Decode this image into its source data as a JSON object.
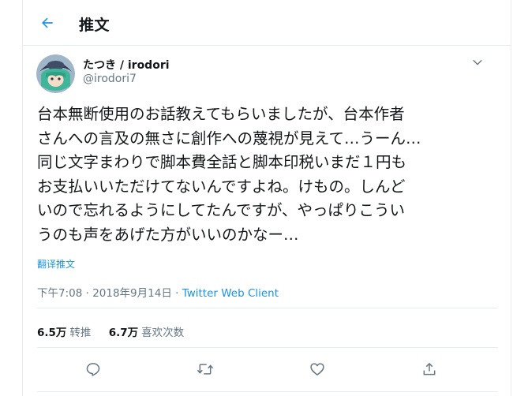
{
  "header": {
    "title": "推文"
  },
  "tweet": {
    "display_name": "たつき / irodori",
    "handle": "@irodori7",
    "lines": [
      "台本無断使用のお話教えてもらいましたが、台本作者",
      "さんへの言及の無さに創作への蔑視が見えて…うーん…",
      "同じ文字まわりで脚本費全話と脚本印税いまだ１円も",
      "お支払いいただけてないんですよね。けもの。しんど",
      "いので忘れるようにしてたんですが、やっぱりこうい",
      "うのも声をあげた方がいいのかなー…"
    ],
    "translate_label": "翻译推文",
    "timestamp": "下午7:08 · 2018年9月14日 · ",
    "client": "Twitter Web Client"
  },
  "stats": {
    "retweets_count": "6.5万",
    "retweets_label": "转推",
    "likes_count": "6.7万",
    "likes_label": "喜欢次数"
  },
  "colors": {
    "accent": "#1b95e0",
    "muted": "#657786",
    "border": "#e6ecf0",
    "text": "#14171a"
  },
  "icons": {
    "back": "arrow-left-icon",
    "more": "chevron-down-icon",
    "reply": "reply-icon",
    "retweet": "retweet-icon",
    "like": "heart-icon",
    "share": "share-icon"
  }
}
